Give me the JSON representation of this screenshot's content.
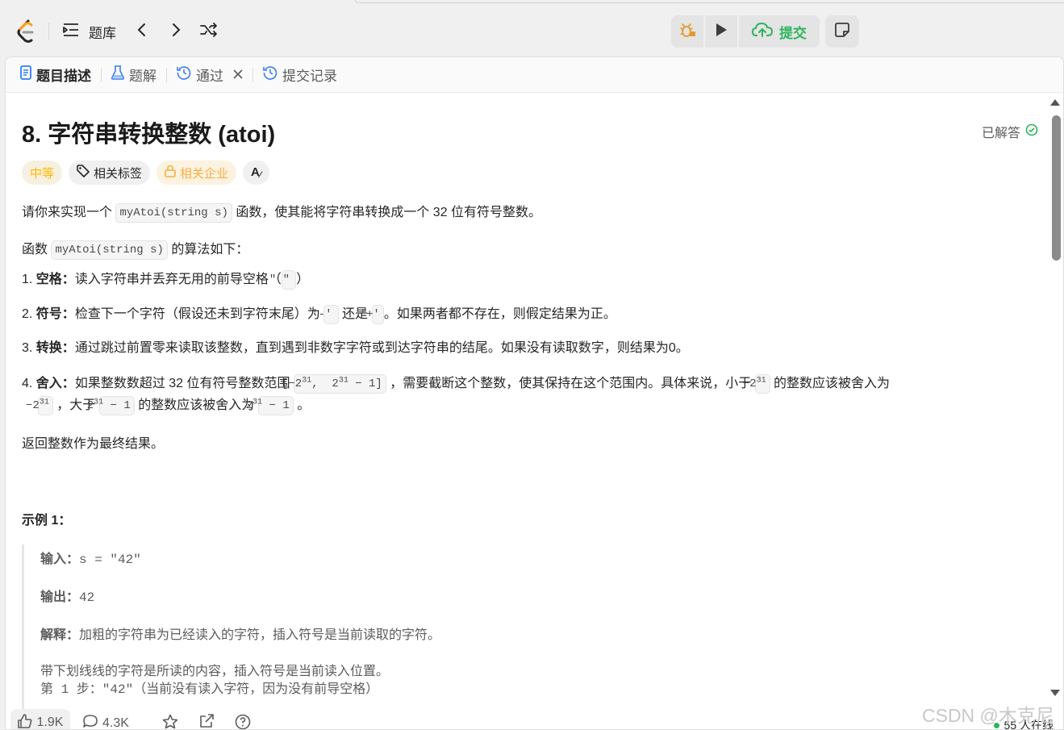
{
  "topbar": {
    "problem_list_label": "题库",
    "submit_label": "提交"
  },
  "tabs": {
    "description": "题目描述",
    "solutions": "题解",
    "accepted": "通过",
    "submissions": "提交记录"
  },
  "problem": {
    "title": "8. 字符串转换整数 (atoi)",
    "status": "已解答",
    "difficulty": "中等",
    "tag_topics": "相关标签",
    "tag_companies": "相关企业",
    "translate_icon_text": "A",
    "intro_pre": "请你来实现一个",
    "intro_code": "myAtoi(string s)",
    "intro_post": "函数，使其能将字符串转换成一个 32 位有符号整数。",
    "algo_pre": "函数",
    "algo_code": "myAtoi(string s)",
    "algo_post": "的算法如下：",
    "rules": {
      "r1_label": "空格：",
      "r1_text": "读入字符串并丢弃无用的前导空格（",
      "r1_code": "\" \"",
      "r1_end": "）",
      "r2_label": "符号：",
      "r2_text": "检查下一个字符（假设还未到字符末尾）为",
      "r2_code1": "'-'",
      "r2_mid": "还是",
      "r2_code2": "'+'",
      "r2_end": "。如果两者都不存在，则假定结果为正。",
      "r3_label": "转换：",
      "r3_text": "通过跳过前置零来读取该整数，直到遇到非数字字符或到达字符串的结尾。如果没有读取数字，则结果为0。",
      "r4_label": "舍入：",
      "r4_text1": "如果整数数超过 32 位有符号整数范围",
      "r4_text2": "，需要截断这个整数，使其保持在这个范围内。具体来说，小于",
      "r4_text3": "的整数应该被舍入为",
      "r4_text4": "，大于",
      "r4_text5": "的整数应该被舍入为",
      "r4_end": "。"
    },
    "return_text": "返回整数作为最终结果。",
    "example_title": "示例 1：",
    "example": {
      "input_label": "输入：",
      "input_value": "s = \"42\"",
      "output_label": "输出：",
      "output_value": "42",
      "explain_label": "解释：",
      "explain_text": "加粗的字符串为已经读入的字符，插入符号是当前读取的字符。",
      "underline_note": "带下划线线的字符是所读的内容，插入符号是当前读入位置。",
      "step1": "第 1 步：\"42\"（当前没有读入字符，因为没有前导空格）"
    }
  },
  "bottom": {
    "likes": "1.9K",
    "comments": "4.3K",
    "online": "55 人在线"
  },
  "watermark": "CSDN @木克尼",
  "colors": {
    "accent_green": "#2db55d",
    "medium_orange": "#ffb800"
  }
}
